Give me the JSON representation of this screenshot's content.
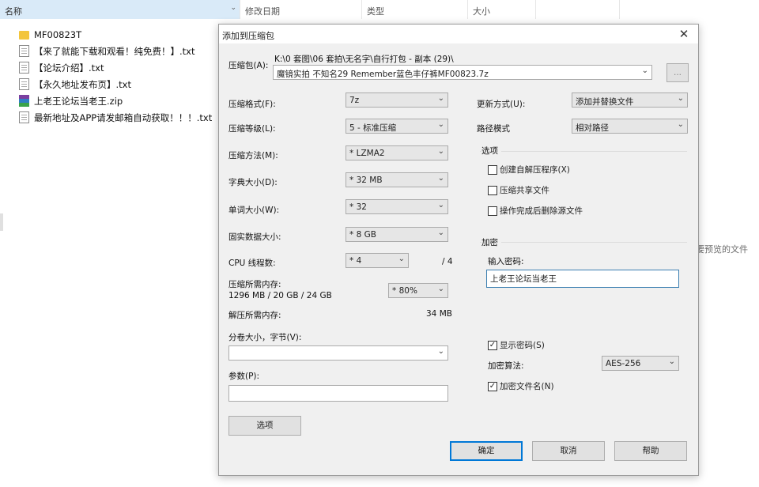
{
  "columns": {
    "name": "名称",
    "date": "修改日期",
    "type": "类型",
    "size": "大小"
  },
  "files": [
    {
      "name": "MF00823T",
      "icon": "folder-icon"
    },
    {
      "name": "【来了就能下载和观看！纯免费！】.txt",
      "icon": "text-file-icon"
    },
    {
      "name": "【论坛介绍】.txt",
      "icon": "text-file-icon"
    },
    {
      "name": "【永久地址发布页】.txt",
      "icon": "text-file-icon"
    },
    {
      "name": "上老王论坛当老王.zip",
      "icon": "archive-icon"
    },
    {
      "name": "最新地址及APP请发邮箱自动获取！！！.txt",
      "icon": "text-file-icon"
    }
  ],
  "empty_hint": "要预览的文件",
  "dialog": {
    "title": "添加到压缩包",
    "archive_label": "压缩包(A):",
    "archive_path": "K:\\0 套图\\06 套拍\\无名字\\自行打包 - 副本 (29)\\",
    "archive_name": "魔镜实拍 不知名29 Remember蓝色丰仔裤MF00823.7z",
    "browse_label": "...",
    "format_label": "压缩格式(F):",
    "format_value": "7z",
    "level_label": "压缩等级(L):",
    "level_value": "5 - 标准压缩",
    "method_label": "压缩方法(M):",
    "method_value": "* LZMA2",
    "dict_label": "字典大小(D):",
    "dict_value": "* 32 MB",
    "word_label": "单词大小(W):",
    "word_value": "* 32",
    "solid_label": "固实数据大小:",
    "solid_value": "* 8 GB",
    "cpu_label": "CPU 线程数:",
    "cpu_value": "* 4",
    "cpu_total": "/ 4",
    "mem_label": "压缩所需内存:",
    "mem_detail": "1296 MB / 20 GB / 24 GB",
    "mem_value": "* 80%",
    "decomp_label": "解压所需内存:",
    "decomp_value": "34 MB",
    "split_label": "分卷大小，字节(V):",
    "split_value": "",
    "params_label": "参数(P):",
    "params_value": "",
    "options_btn": "选项",
    "update_label": "更新方式(U):",
    "update_value": "添加并替换文件",
    "path_label": "路径模式",
    "path_value": "相对路径",
    "options_group": "选项",
    "opt_sfx": "创建自解压程序(X)",
    "opt_shared": "压缩共享文件",
    "opt_delete": "操作完成后删除源文件",
    "enc_group": "加密",
    "pwd_label": "输入密码:",
    "pwd_value": "上老王论坛当老王",
    "show_pwd": "显示密码(S)",
    "enc_method_label": "加密算法:",
    "enc_method_value": "AES-256",
    "enc_names": "加密文件名(N)",
    "ok": "确定",
    "cancel": "取消",
    "help": "帮助"
  }
}
